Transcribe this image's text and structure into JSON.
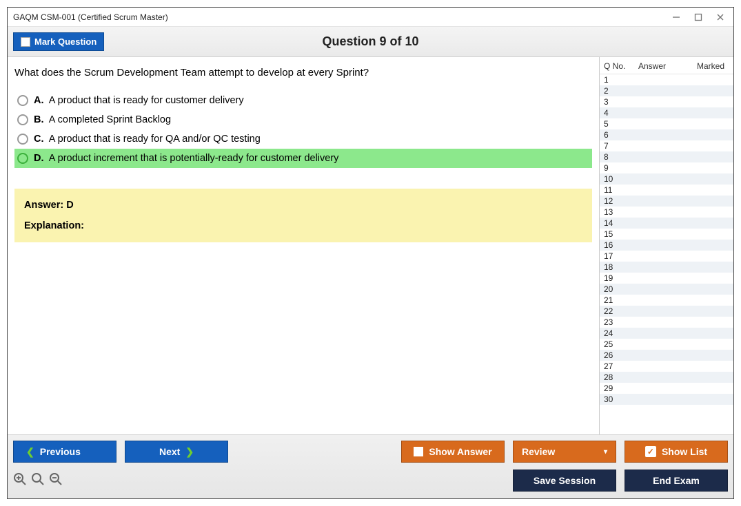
{
  "window": {
    "title": "GAQM CSM-001 (Certified Scrum Master)"
  },
  "toolbar": {
    "mark_label": "Mark Question",
    "counter": "Question 9 of 10"
  },
  "question": {
    "text": "What does the Scrum Development Team attempt to develop at every Sprint?",
    "choices": [
      {
        "letter": "A.",
        "text": "A product that is ready for customer delivery",
        "highlight": false
      },
      {
        "letter": "B.",
        "text": "A completed Sprint Backlog",
        "highlight": false
      },
      {
        "letter": "C.",
        "text": "A product that is ready for QA and/or QC testing",
        "highlight": false
      },
      {
        "letter": "D.",
        "text": "A product increment that is potentially-ready for customer delivery",
        "highlight": true
      }
    ],
    "answer_label": "Answer: D",
    "explanation_label": "Explanation:"
  },
  "sidepanel": {
    "headers": {
      "qno": "Q No.",
      "answer": "Answer",
      "marked": "Marked"
    },
    "rows": [
      {
        "n": "1"
      },
      {
        "n": "2"
      },
      {
        "n": "3"
      },
      {
        "n": "4"
      },
      {
        "n": "5"
      },
      {
        "n": "6"
      },
      {
        "n": "7"
      },
      {
        "n": "8"
      },
      {
        "n": "9"
      },
      {
        "n": "10"
      },
      {
        "n": "11"
      },
      {
        "n": "12"
      },
      {
        "n": "13"
      },
      {
        "n": "14"
      },
      {
        "n": "15"
      },
      {
        "n": "16"
      },
      {
        "n": "17"
      },
      {
        "n": "18"
      },
      {
        "n": "19"
      },
      {
        "n": "20"
      },
      {
        "n": "21"
      },
      {
        "n": "22"
      },
      {
        "n": "23"
      },
      {
        "n": "24"
      },
      {
        "n": "25"
      },
      {
        "n": "26"
      },
      {
        "n": "27"
      },
      {
        "n": "28"
      },
      {
        "n": "29"
      },
      {
        "n": "30"
      }
    ]
  },
  "footer": {
    "previous": "Previous",
    "next": "Next",
    "show_answer": "Show Answer",
    "review": "Review",
    "show_list": "Show List",
    "save_session": "Save Session",
    "end_exam": "End Exam"
  }
}
